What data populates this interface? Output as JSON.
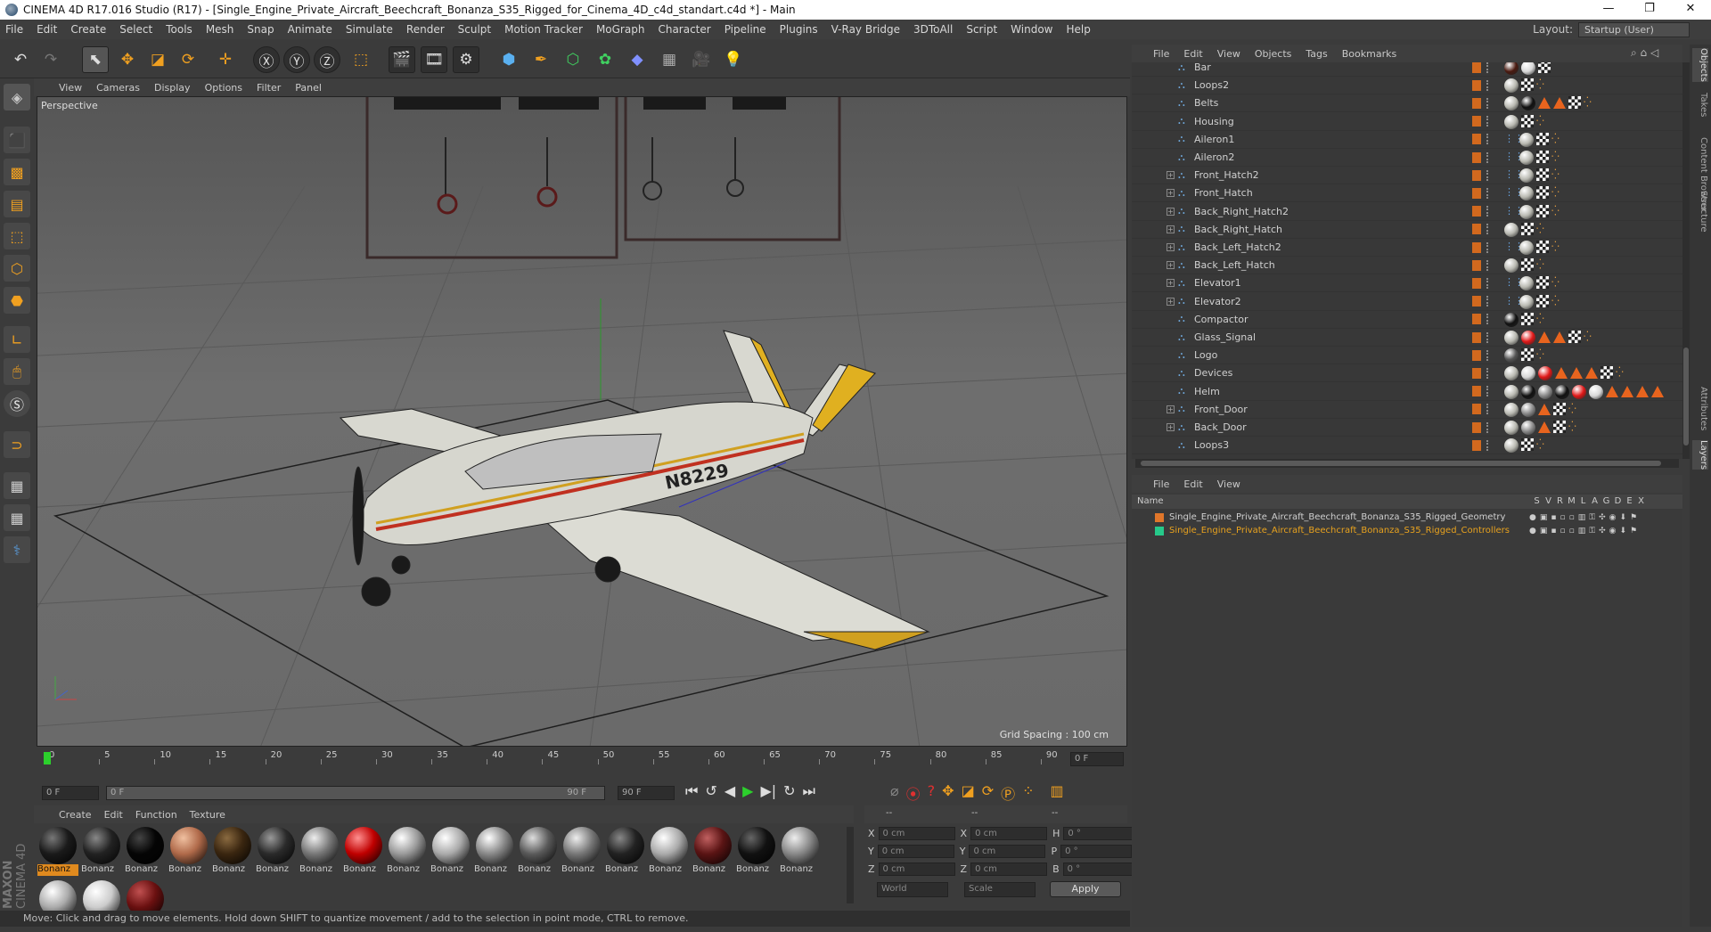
{
  "window": {
    "title": "CINEMA 4D R17.016 Studio (R17) - [Single_Engine_Private_Aircraft_Beechcraft_Bonanza_S35_Rigged_for_Cinema_4D_c4d_standart.c4d *] - Main",
    "controls": [
      "—",
      "❐",
      "✕"
    ]
  },
  "menubar": [
    "File",
    "Edit",
    "Create",
    "Select",
    "Tools",
    "Mesh",
    "Snap",
    "Animate",
    "Simulate",
    "Render",
    "Sculpt",
    "Motion Tracker",
    "MoGraph",
    "Character",
    "Pipeline",
    "Plugins",
    "V-Ray Bridge",
    "3DToAll",
    "Script",
    "Window",
    "Help"
  ],
  "layout": {
    "label": "Layout:",
    "value": "Startup (User)"
  },
  "viewport": {
    "menu": [
      "View",
      "Cameras",
      "Display",
      "Options",
      "Filter",
      "Panel"
    ],
    "name": "Perspective",
    "grid_spacing": "Grid Spacing : 100 cm",
    "tail_number": "N8229"
  },
  "timeline": {
    "ticks": [
      "0",
      "5",
      "10",
      "15",
      "20",
      "25",
      "30",
      "35",
      "40",
      "45",
      "50",
      "55",
      "60",
      "65",
      "70",
      "75",
      "80",
      "85",
      "90"
    ],
    "current_frame": "0 F",
    "start": "0 F",
    "range_start": "0 F",
    "range_end": "90 F",
    "end": "90 F"
  },
  "material_menu": [
    "Create",
    "Edit",
    "Function",
    "Texture"
  ],
  "materials": [
    {
      "label": "Bonanz",
      "color": "#1a1a1a",
      "hl": "#777",
      "selected": true
    },
    {
      "label": "Bonanz",
      "color": "#222",
      "hl": "#888"
    },
    {
      "label": "Bonanz",
      "color": "#050505",
      "hl": "#444"
    },
    {
      "label": "Bonanz",
      "color": "#b06a4a",
      "hl": "#f0c0a0"
    },
    {
      "label": "Bonanz",
      "color": "#3a2610",
      "hl": "#8a6a40"
    },
    {
      "label": "Bonanz",
      "color": "#2a2a2a",
      "hl": "#999"
    },
    {
      "label": "Bonanz",
      "color": "#777",
      "hl": "#eee",
      "pattern": true
    },
    {
      "label": "Bonanz",
      "color": "#c00000",
      "hl": "#ff9090"
    },
    {
      "label": "Bonanz",
      "color": "#999",
      "hl": "#fff"
    },
    {
      "label": "Bonanz",
      "color": "#aaa",
      "hl": "#fff"
    },
    {
      "label": "Bonanz",
      "color": "#888",
      "hl": "#fff"
    },
    {
      "label": "Bonanz",
      "color": "#5a5a5a",
      "hl": "#ddd"
    },
    {
      "label": "Bonanz",
      "color": "#777",
      "hl": "#eee"
    },
    {
      "label": "Bonanz",
      "color": "#222",
      "hl": "#888"
    },
    {
      "label": "Bonanz",
      "color": "#aaa",
      "hl": "#fff"
    },
    {
      "label": "Bonanz",
      "color": "#5a1414",
      "hl": "#c06060"
    },
    {
      "label": "Bonanz",
      "color": "#111",
      "hl": "#666"
    },
    {
      "label": "Bonanz",
      "color": "#888",
      "hl": "#eee"
    },
    {
      "label": "",
      "color": "#aaa",
      "hl": "#fff"
    },
    {
      "label": "",
      "color": "#ccc",
      "hl": "#fff"
    },
    {
      "label": "",
      "color": "#6a1010",
      "hl": "#c05050"
    }
  ],
  "coords": {
    "header": [
      "--",
      "--",
      "--"
    ],
    "rows": [
      {
        "a": "X",
        "av": "0 cm",
        "b": "X",
        "bv": "0 cm",
        "c": "H",
        "cv": "0 °"
      },
      {
        "a": "Y",
        "av": "0 cm",
        "b": "Y",
        "bv": "0 cm",
        "c": "P",
        "cv": "0 °"
      },
      {
        "a": "Z",
        "av": "0 cm",
        "b": "Z",
        "bv": "0 cm",
        "c": "B",
        "cv": "0 °"
      }
    ],
    "world": "World",
    "scale": "Scale",
    "apply": "Apply"
  },
  "status": "Move: Click and drag to move elements. Hold down SHIFT to quantize movement / add to the selection in point mode, CTRL to remove.",
  "objects_menu": [
    "File",
    "Edit",
    "View",
    "Objects",
    "Tags",
    "Bookmarks"
  ],
  "objects": [
    {
      "name": "Bar",
      "expand": false,
      "tags": "mwc"
    },
    {
      "name": "Loops2",
      "expand": false,
      "tags": "pcx"
    },
    {
      "name": "Belts",
      "expand": false,
      "tags": "pbttcx"
    },
    {
      "name": "Housing",
      "expand": false,
      "tags": "pcx"
    },
    {
      "name": "Aileron1",
      "expand": false,
      "tags": "dpcx"
    },
    {
      "name": "Aileron2",
      "expand": false,
      "tags": "dpcx"
    },
    {
      "name": "Front_Hatch2",
      "expand": true,
      "tags": "dpcx"
    },
    {
      "name": "Front_Hatch",
      "expand": true,
      "tags": "dpcx"
    },
    {
      "name": "Back_Right_Hatch2",
      "expand": true,
      "tags": "dpcx"
    },
    {
      "name": "Back_Right_Hatch",
      "expand": true,
      "tags": "pcx"
    },
    {
      "name": "Back_Left_Hatch2",
      "expand": true,
      "tags": "dpcx"
    },
    {
      "name": "Back_Left_Hatch",
      "expand": true,
      "tags": "pcx"
    },
    {
      "name": "Elevator1",
      "expand": true,
      "tags": "dpcx"
    },
    {
      "name": "Elevator2",
      "expand": true,
      "tags": "dpcx"
    },
    {
      "name": "Compactor",
      "expand": false,
      "tags": "bcx"
    },
    {
      "name": "Glass_Signal",
      "expand": false,
      "tags": "prttcx"
    },
    {
      "name": "Logo",
      "expand": false,
      "tags": "lcx"
    },
    {
      "name": "Devices",
      "expand": false,
      "tags": "pwrtttcx"
    },
    {
      "name": "Helm",
      "expand": false,
      "tags": "pbsbrwtttt"
    },
    {
      "name": "Front_Door",
      "expand": true,
      "tags": "pstcx"
    },
    {
      "name": "Back_Door",
      "expand": true,
      "tags": "pstcx"
    },
    {
      "name": "Loops3",
      "expand": false,
      "tags": "pcx"
    }
  ],
  "layers_menu": [
    "File",
    "Edit",
    "View"
  ],
  "layers_header": {
    "name": "Name",
    "cols": [
      "S",
      "V",
      "R",
      "M",
      "L",
      "A",
      "G",
      "D",
      "E",
      "X"
    ]
  },
  "layers": [
    {
      "name": "Single_Engine_Private_Aircraft_Beechcraft_Bonanza_S35_Rigged_Geometry",
      "color": "#e0762a",
      "text": "#d0d0d0"
    },
    {
      "name": "Single_Engine_Private_Aircraft_Beechcraft_Bonanza_S35_Rigged_Controllers",
      "color": "#26c98a",
      "text": "#e8a21e"
    }
  ],
  "right_tabs": [
    "Objects",
    "Takes",
    "Content Browser",
    "Structure",
    "Attributes",
    "Layers"
  ]
}
